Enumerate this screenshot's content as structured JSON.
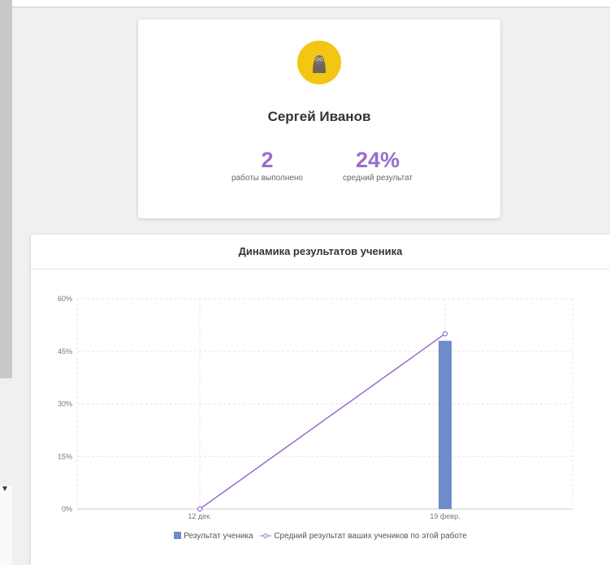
{
  "colors": {
    "accent": "#9a6ccb",
    "bar": "#6d8cc9",
    "line": "#9a6ccb",
    "avatar_bg": "#f3c613"
  },
  "profile": {
    "name": "Сергей Иванов",
    "avatar_icon": "user-avatar-icon",
    "stats": [
      {
        "value": "2",
        "label": "работы выполнено"
      },
      {
        "value": "24%",
        "label": "средний результат"
      }
    ]
  },
  "chart": {
    "title": "Динамика результатов ученика"
  },
  "chart_data": {
    "type": "bar",
    "categories": [
      "12 дек.",
      "19 февр."
    ],
    "series": [
      {
        "name": "Результат ученика",
        "type": "bar",
        "values": [
          0,
          48
        ]
      },
      {
        "name": "Средний результат ваших учеников по этой работе",
        "type": "line",
        "values": [
          0,
          50
        ]
      }
    ],
    "y_ticks": [
      "0%",
      "15%",
      "30%",
      "45%",
      "60%"
    ],
    "ylim": [
      0,
      60
    ],
    "grid": true,
    "legend_position": "bottom"
  }
}
